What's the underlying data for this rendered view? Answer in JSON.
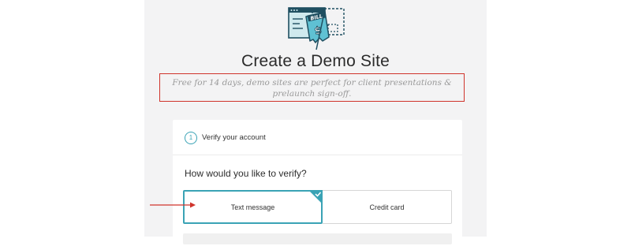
{
  "header": {
    "logo_icon": "bill-browser-icon",
    "logo_text": "BILL",
    "title": "Create a Demo Site",
    "subtitle": "Free for 14 days, demo sites are perfect for client presentations & prelaunch sign-off."
  },
  "verify": {
    "step_number": "1",
    "step_label": "Verify your account",
    "question": "How would you like to verify?",
    "options": [
      {
        "label": "Text message",
        "selected": true
      },
      {
        "label": "Credit card",
        "selected": false
      }
    ]
  },
  "annotations": {
    "highlight_color": "#d0342c",
    "accent_color": "#3aa3b5"
  }
}
